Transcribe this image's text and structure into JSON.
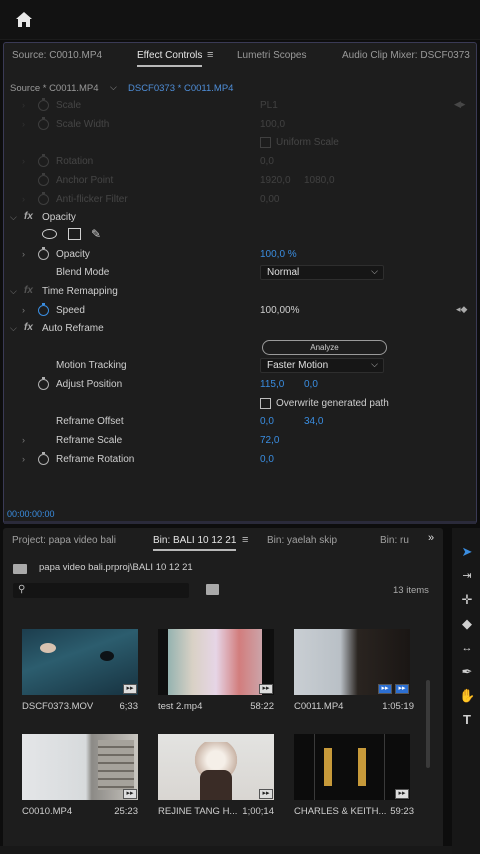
{
  "panel_tabs": {
    "source": "Source: C0010.MP4",
    "effect_controls": "Effect Controls",
    "menu": "≡",
    "lumetri": "Lumetri Scopes",
    "mixer": "Audio Clip Mixer: DSCF0373"
  },
  "source_bar": {
    "left": "Source * C0011.MP4",
    "right": "DSCF0373 * C0011.MP4"
  },
  "motion_rows": [
    {
      "label": "Scale",
      "value": "PL1"
    },
    {
      "label": "Scale Width",
      "value": "100,0"
    },
    {
      "label": "Uniform Scale",
      "value": ""
    },
    {
      "label": "Rotation",
      "value": "0,0"
    },
    {
      "label": "Anchor Point",
      "value": "1920,0",
      "value2": "1080,0"
    },
    {
      "label": "Anti-flicker Filter",
      "value": "0,00"
    }
  ],
  "opacity": {
    "section": "Opacity",
    "label": "Opacity",
    "value": "100,0 %",
    "blend_label": "Blend Mode",
    "blend_value": "Normal"
  },
  "time_remap": {
    "section": "Time Remapping",
    "speed_label": "Speed",
    "speed_value": "100,00%"
  },
  "auto_reframe": {
    "section": "Auto Reframe",
    "analyze": "Analyze",
    "tracking_label": "Motion Tracking",
    "tracking_value": "Faster Motion",
    "adjust_label": "Adjust Position",
    "adjust_x": "115,0",
    "adjust_y": "0,0",
    "overwrite": "Overwrite generated path",
    "offset_label": "Reframe Offset",
    "offset_x": "0,0",
    "offset_y": "34,0",
    "scale_label": "Reframe Scale",
    "scale_value": "72,0",
    "rotation_label": "Reframe Rotation",
    "rotation_value": "0,0"
  },
  "timecode": "00:00:00:00",
  "project": {
    "tabs": [
      "Project: papa video bali",
      "Bin: BALI 10 12 21",
      "Bin: yaelah skip",
      "Bin: ru"
    ],
    "menu": "≡",
    "more": "»",
    "path": "papa video bali.prproj\\BALI 10 12 21",
    "items": "13 items",
    "clips": [
      {
        "name": "DSCF0373.MOV",
        "duration": "6;33"
      },
      {
        "name": "test 2.mp4",
        "duration": "58:22"
      },
      {
        "name": "C0011.MP4",
        "duration": "1:05:19"
      },
      {
        "name": "C0010.MP4",
        "duration": "25:23"
      },
      {
        "name": "REJINE TANG H...",
        "duration": "1;00;14"
      },
      {
        "name": "CHARLES & KEITH...",
        "duration": "59:23"
      }
    ]
  },
  "tools": [
    "selection-tool",
    "track-select-tool",
    "ripple-edit-tool",
    "razor-tool",
    "slip-tool",
    "pen-tool",
    "hand-tool",
    "type-tool"
  ]
}
